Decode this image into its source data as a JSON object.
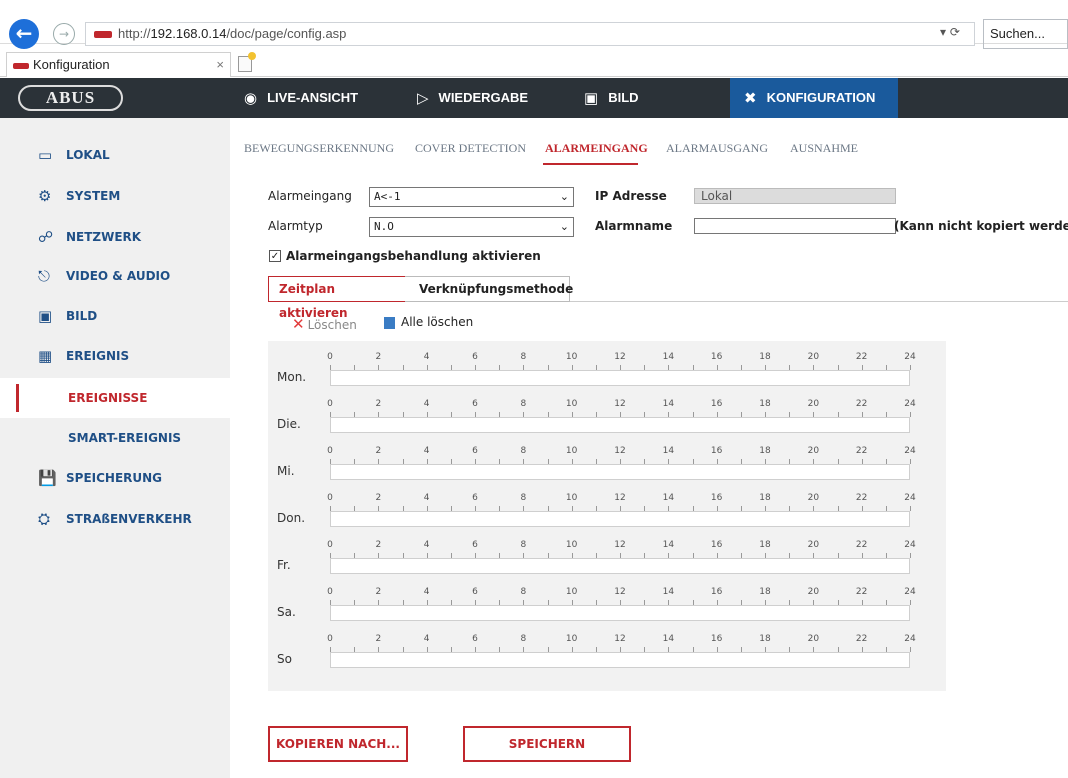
{
  "browser": {
    "url_prefix": "http://",
    "url_host": "192.168.0.14",
    "url_path": "/doc/page/config.asp",
    "search_placeholder": "Suchen...",
    "tab_title": "Konfiguration",
    "tab_close": "×",
    "url_tools": "▾ ⟳"
  },
  "header": {
    "logo": "ABUS",
    "nav": [
      {
        "label": "LIVE-ANSICHT",
        "icon": "eye-icon"
      },
      {
        "label": "WIEDERGABE",
        "icon": "play-icon"
      },
      {
        "label": "BILD",
        "icon": "image-icon"
      },
      {
        "label": "KONFIGURATION",
        "icon": "tools-icon"
      }
    ]
  },
  "sidebar": {
    "items": [
      {
        "label": "LOKAL",
        "icon": "monitor-icon"
      },
      {
        "label": "SYSTEM",
        "icon": "gear-icon"
      },
      {
        "label": "NETZWERK",
        "icon": "network-icon"
      },
      {
        "label": "VIDEO & AUDIO",
        "icon": "microphone-icon"
      },
      {
        "label": "BILD",
        "icon": "image-icon"
      },
      {
        "label": "EREIGNIS",
        "icon": "calendar-icon"
      },
      {
        "label": "EREIGNISSE",
        "icon": ""
      },
      {
        "label": "SMART-EREIGNIS",
        "icon": ""
      },
      {
        "label": "SPEICHERUNG",
        "icon": "save-icon"
      },
      {
        "label": "STRAßENVERKEHR",
        "icon": "traffic-icon"
      }
    ],
    "active": "EREIGNISSE"
  },
  "content_tabs": [
    "BEWEGUNGSERKENNUNG",
    "COVER DETECTION",
    "ALARMEINGANG",
    "ALARMAUSGANG",
    "AUSNAHME"
  ],
  "active_tab": "ALARMEINGANG",
  "form": {
    "alarmeingang_label": "Alarmeingang",
    "alarmeingang_value": "A<-1",
    "ip_label": "IP Adresse",
    "ip_value": "Lokal",
    "alarmtyp_label": "Alarmtyp",
    "alarmtyp_value": "N.O",
    "alarmname_label": "Alarmname",
    "alarmname_value": "",
    "alarmname_note": "(Kann nicht kopiert werden)",
    "checkbox_label": "Alarmeingangsbehandlung aktivieren",
    "checkbox_checked": true
  },
  "subtabs": {
    "schedule": "Zeitplan aktivieren",
    "linkage": "Verknüpfungsmethode"
  },
  "toolbar": {
    "delete": "Löschen",
    "delete_all": "Alle löschen"
  },
  "schedule": {
    "days": [
      "Mon.",
      "Die.",
      "Mi.",
      "Don.",
      "Fr.",
      "Sa.",
      "So"
    ],
    "hours": [
      "0",
      "2",
      "4",
      "6",
      "8",
      "10",
      "12",
      "14",
      "16",
      "18",
      "20",
      "22",
      "24"
    ]
  },
  "buttons": {
    "copy": "KOPIEREN NACH...",
    "save": "SPEICHERN"
  }
}
